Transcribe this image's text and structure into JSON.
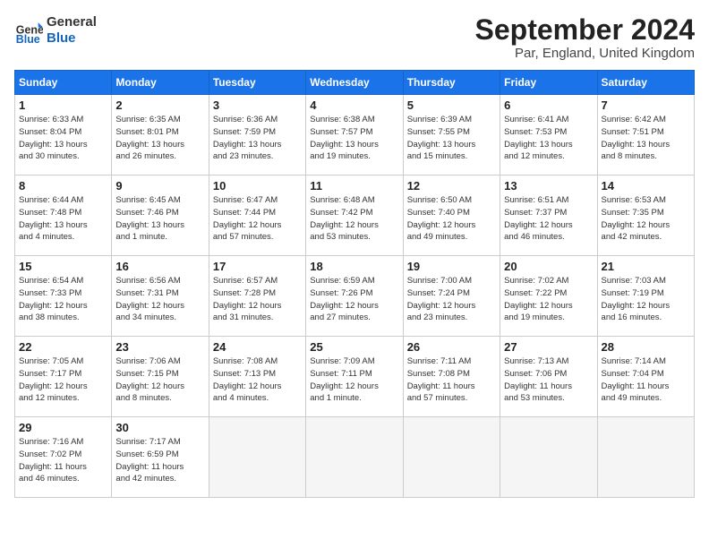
{
  "header": {
    "logo_general": "General",
    "logo_blue": "Blue",
    "month_title": "September 2024",
    "location": "Par, England, United Kingdom"
  },
  "days_of_week": [
    "Sunday",
    "Monday",
    "Tuesday",
    "Wednesday",
    "Thursday",
    "Friday",
    "Saturday"
  ],
  "weeks": [
    [
      {
        "day": "1",
        "info": "Sunrise: 6:33 AM\nSunset: 8:04 PM\nDaylight: 13 hours\nand 30 minutes."
      },
      {
        "day": "2",
        "info": "Sunrise: 6:35 AM\nSunset: 8:01 PM\nDaylight: 13 hours\nand 26 minutes."
      },
      {
        "day": "3",
        "info": "Sunrise: 6:36 AM\nSunset: 7:59 PM\nDaylight: 13 hours\nand 23 minutes."
      },
      {
        "day": "4",
        "info": "Sunrise: 6:38 AM\nSunset: 7:57 PM\nDaylight: 13 hours\nand 19 minutes."
      },
      {
        "day": "5",
        "info": "Sunrise: 6:39 AM\nSunset: 7:55 PM\nDaylight: 13 hours\nand 15 minutes."
      },
      {
        "day": "6",
        "info": "Sunrise: 6:41 AM\nSunset: 7:53 PM\nDaylight: 13 hours\nand 12 minutes."
      },
      {
        "day": "7",
        "info": "Sunrise: 6:42 AM\nSunset: 7:51 PM\nDaylight: 13 hours\nand 8 minutes."
      }
    ],
    [
      {
        "day": "8",
        "info": "Sunrise: 6:44 AM\nSunset: 7:48 PM\nDaylight: 13 hours\nand 4 minutes."
      },
      {
        "day": "9",
        "info": "Sunrise: 6:45 AM\nSunset: 7:46 PM\nDaylight: 13 hours\nand 1 minute."
      },
      {
        "day": "10",
        "info": "Sunrise: 6:47 AM\nSunset: 7:44 PM\nDaylight: 12 hours\nand 57 minutes."
      },
      {
        "day": "11",
        "info": "Sunrise: 6:48 AM\nSunset: 7:42 PM\nDaylight: 12 hours\nand 53 minutes."
      },
      {
        "day": "12",
        "info": "Sunrise: 6:50 AM\nSunset: 7:40 PM\nDaylight: 12 hours\nand 49 minutes."
      },
      {
        "day": "13",
        "info": "Sunrise: 6:51 AM\nSunset: 7:37 PM\nDaylight: 12 hours\nand 46 minutes."
      },
      {
        "day": "14",
        "info": "Sunrise: 6:53 AM\nSunset: 7:35 PM\nDaylight: 12 hours\nand 42 minutes."
      }
    ],
    [
      {
        "day": "15",
        "info": "Sunrise: 6:54 AM\nSunset: 7:33 PM\nDaylight: 12 hours\nand 38 minutes."
      },
      {
        "day": "16",
        "info": "Sunrise: 6:56 AM\nSunset: 7:31 PM\nDaylight: 12 hours\nand 34 minutes."
      },
      {
        "day": "17",
        "info": "Sunrise: 6:57 AM\nSunset: 7:28 PM\nDaylight: 12 hours\nand 31 minutes."
      },
      {
        "day": "18",
        "info": "Sunrise: 6:59 AM\nSunset: 7:26 PM\nDaylight: 12 hours\nand 27 minutes."
      },
      {
        "day": "19",
        "info": "Sunrise: 7:00 AM\nSunset: 7:24 PM\nDaylight: 12 hours\nand 23 minutes."
      },
      {
        "day": "20",
        "info": "Sunrise: 7:02 AM\nSunset: 7:22 PM\nDaylight: 12 hours\nand 19 minutes."
      },
      {
        "day": "21",
        "info": "Sunrise: 7:03 AM\nSunset: 7:19 PM\nDaylight: 12 hours\nand 16 minutes."
      }
    ],
    [
      {
        "day": "22",
        "info": "Sunrise: 7:05 AM\nSunset: 7:17 PM\nDaylight: 12 hours\nand 12 minutes."
      },
      {
        "day": "23",
        "info": "Sunrise: 7:06 AM\nSunset: 7:15 PM\nDaylight: 12 hours\nand 8 minutes."
      },
      {
        "day": "24",
        "info": "Sunrise: 7:08 AM\nSunset: 7:13 PM\nDaylight: 12 hours\nand 4 minutes."
      },
      {
        "day": "25",
        "info": "Sunrise: 7:09 AM\nSunset: 7:11 PM\nDaylight: 12 hours\nand 1 minute."
      },
      {
        "day": "26",
        "info": "Sunrise: 7:11 AM\nSunset: 7:08 PM\nDaylight: 11 hours\nand 57 minutes."
      },
      {
        "day": "27",
        "info": "Sunrise: 7:13 AM\nSunset: 7:06 PM\nDaylight: 11 hours\nand 53 minutes."
      },
      {
        "day": "28",
        "info": "Sunrise: 7:14 AM\nSunset: 7:04 PM\nDaylight: 11 hours\nand 49 minutes."
      }
    ],
    [
      {
        "day": "29",
        "info": "Sunrise: 7:16 AM\nSunset: 7:02 PM\nDaylight: 11 hours\nand 46 minutes."
      },
      {
        "day": "30",
        "info": "Sunrise: 7:17 AM\nSunset: 6:59 PM\nDaylight: 11 hours\nand 42 minutes."
      },
      {
        "day": "",
        "info": ""
      },
      {
        "day": "",
        "info": ""
      },
      {
        "day": "",
        "info": ""
      },
      {
        "day": "",
        "info": ""
      },
      {
        "day": "",
        "info": ""
      }
    ]
  ]
}
